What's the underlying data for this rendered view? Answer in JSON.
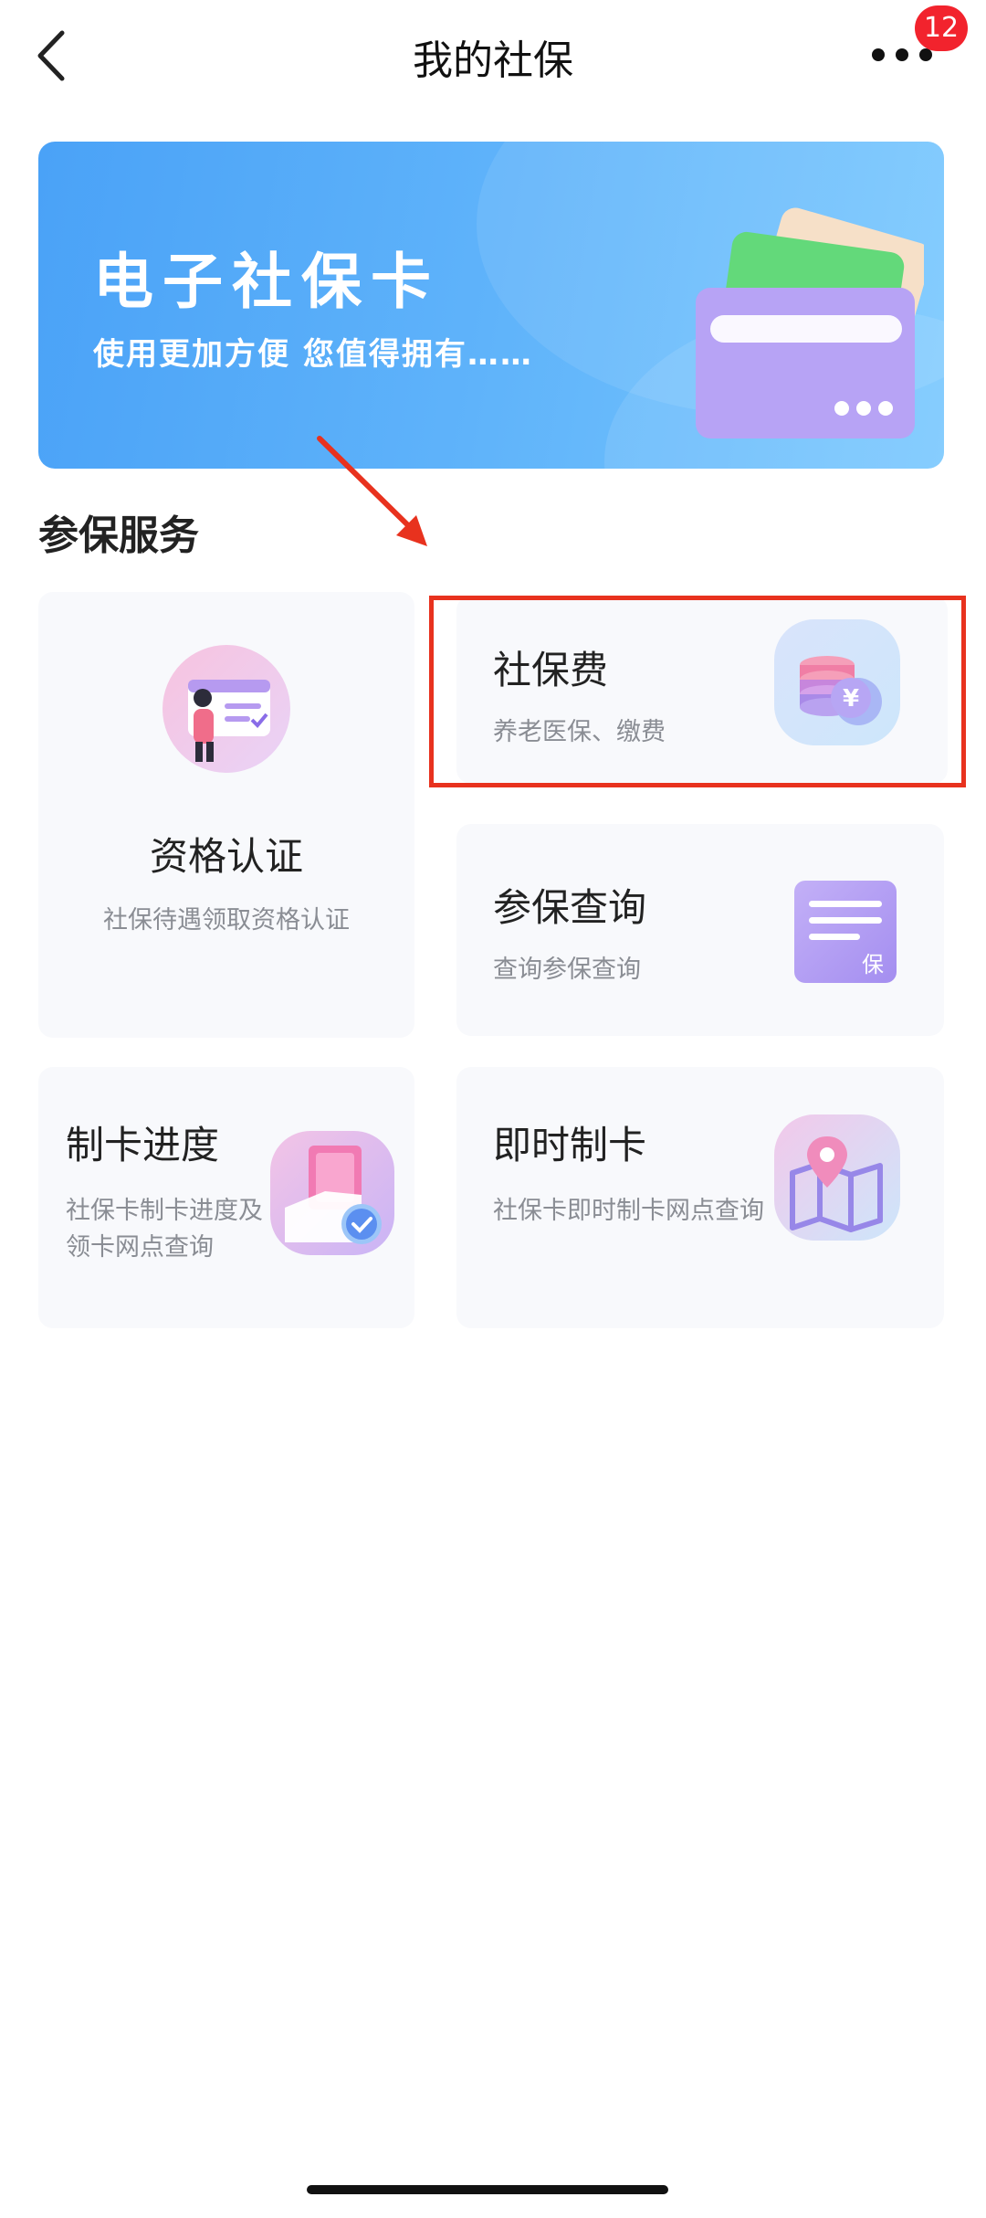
{
  "nav": {
    "title": "我的社保",
    "badge_count": "12"
  },
  "banner": {
    "title": "电子社保卡",
    "subtitle": "使用更加方便 您值得拥有……"
  },
  "section": {
    "title": "参保服务"
  },
  "tiles": {
    "qualification": {
      "title": "资格认证",
      "desc": "社保待遇领取资格认证"
    },
    "fee": {
      "title": "社保费",
      "desc": "养老医保、缴费"
    },
    "query": {
      "title": "参保查询",
      "desc": "查询参保查询",
      "icon_text": "保"
    },
    "progress": {
      "title": "制卡进度",
      "desc": "社保卡制卡进度及领卡网点查询"
    },
    "instant": {
      "title": "即时制卡",
      "desc": "社保卡即时制卡网点查询"
    }
  },
  "icons": {
    "back": "chevron-left-icon",
    "more": "more-dots-icon",
    "banner": "social-security-card-icon",
    "qualification": "person-card-icon",
    "fee": "coin-stack-yuan-icon",
    "query": "document-bao-icon",
    "progress": "card-check-icon",
    "instant": "map-location-icon"
  },
  "colors": {
    "accent": "#4aa2f7",
    "annotation": "#e8321e",
    "badge": "#f2232d"
  }
}
